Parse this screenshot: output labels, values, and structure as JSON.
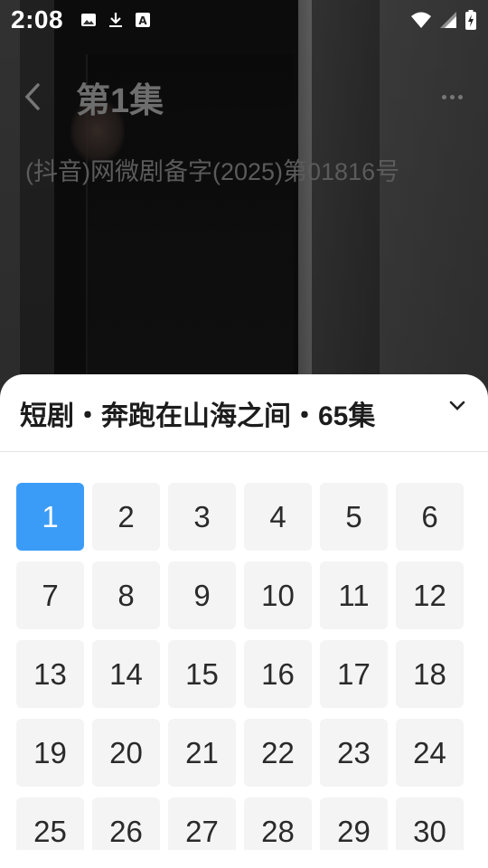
{
  "status_bar": {
    "time": "2:08",
    "left_icons": [
      "image-icon",
      "download-icon",
      "text-a-icon"
    ],
    "right_icons": [
      "wifi-icon",
      "signal-icon",
      "battery-charging-icon"
    ]
  },
  "video": {
    "episode_title": "第1集",
    "license": "(抖音)网微剧备字(2025)第01816号"
  },
  "sheet": {
    "title": "短剧・奔跑在山海之间・65集",
    "selected_episode": "1",
    "episodes": [
      "1",
      "2",
      "3",
      "4",
      "5",
      "6",
      "7",
      "8",
      "9",
      "10",
      "11",
      "12",
      "13",
      "14",
      "15",
      "16",
      "17",
      "18",
      "19",
      "20",
      "21",
      "22",
      "23",
      "24",
      "25",
      "26",
      "27",
      "28",
      "29",
      "30"
    ]
  },
  "colors": {
    "accent": "#3b9cf8",
    "cell_bg": "#f4f4f4"
  }
}
